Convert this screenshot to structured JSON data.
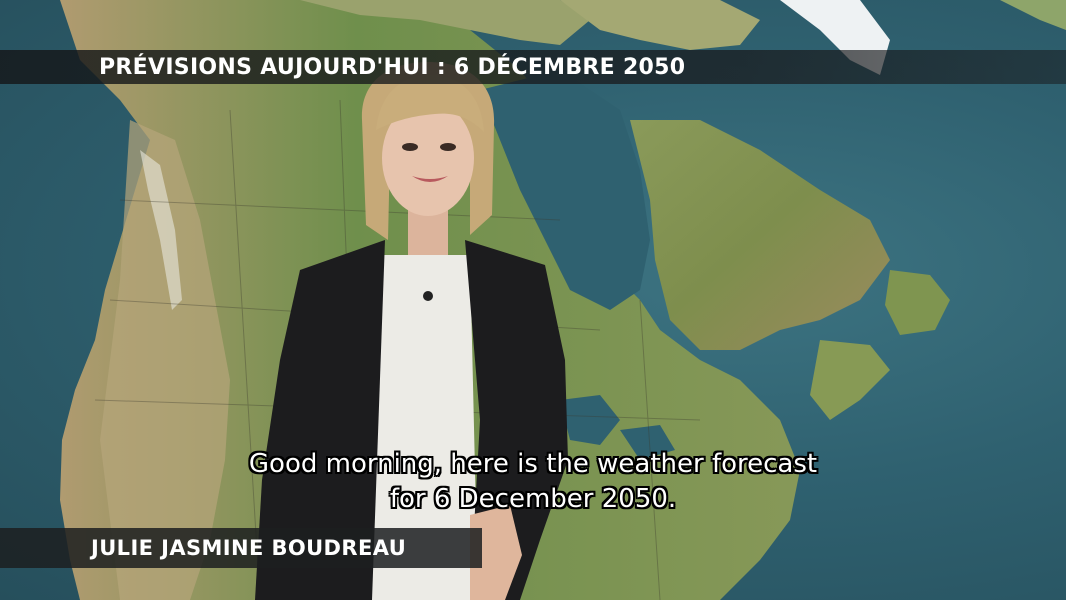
{
  "broadcast": {
    "title_bar_text": "PRÉVISIONS AUJOURD'HUI : 6 DÉCEMBRE 2050",
    "presenter_name": "JULIE JASMINE BOUDREAU"
  },
  "subtitles": {
    "line1": "Good morning, here is the weather forecast",
    "line2": "for 6 December 2050."
  },
  "scene": {
    "description_colors": {
      "ocean": "#2f6170",
      "land_green": "#6e8f4a",
      "land_tan": "#a99066",
      "ice": "#e9eef0",
      "jacket": "#1c1c1e",
      "blouse": "#ecebe6",
      "hair": "#c9ad7b"
    }
  }
}
